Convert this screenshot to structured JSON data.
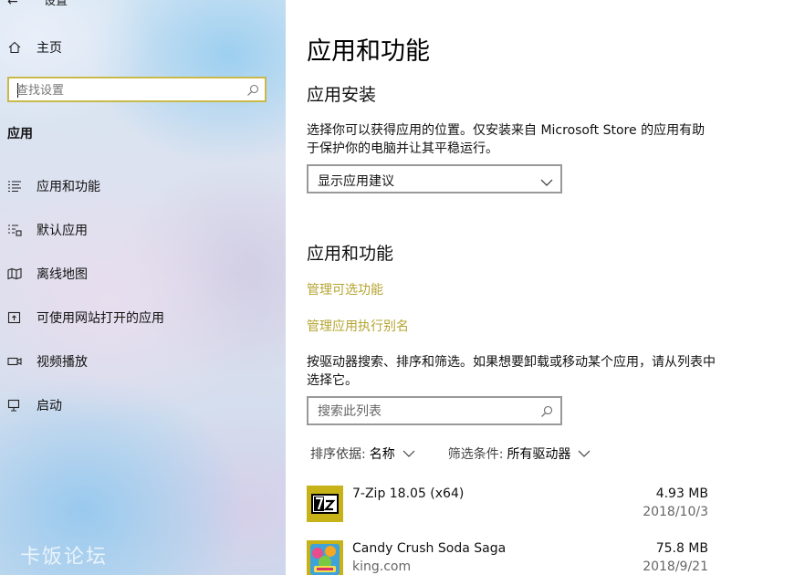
{
  "sidebar": {
    "back_title": "设置",
    "home_label": "主页",
    "search_placeholder": "查找设置",
    "section_title": "应用",
    "items": [
      {
        "label": "应用和功能",
        "icon": "apps-features-icon"
      },
      {
        "label": "默认应用",
        "icon": "default-apps-icon"
      },
      {
        "label": "离线地图",
        "icon": "offline-maps-icon"
      },
      {
        "label": "可使用网站打开的应用",
        "icon": "apps-for-websites-icon"
      },
      {
        "label": "视频播放",
        "icon": "video-playback-icon"
      },
      {
        "label": "启动",
        "icon": "startup-icon"
      }
    ],
    "watermark": "卡饭论坛"
  },
  "main": {
    "title": "应用和功能",
    "install_heading": "应用安装",
    "install_description": "选择你可以获得应用的位置。仅安装来自 Microsoft Store 的应用有助于保护你的电脑并让其平稳运行。",
    "install_dropdown_value": "显示应用建议",
    "features_heading": "应用和功能",
    "link_optional_features": "管理可选功能",
    "link_app_aliases": "管理应用执行别名",
    "list_description": "按驱动器搜索、排序和筛选。如果想要卸载或移动某个应用，请从列表中选择它。",
    "list_search_placeholder": "搜索此列表",
    "sort_label": "排序依据:",
    "sort_value": "名称",
    "filter_label": "筛选条件:",
    "filter_value": "所有驱动器",
    "apps": [
      {
        "name": "7-Zip 18.05 (x64)",
        "publisher": "",
        "size": "4.93 MB",
        "date": "2018/10/3",
        "icon": "7zip-icon"
      },
      {
        "name": "Candy Crush Soda Saga",
        "publisher": "king.com",
        "size": "75.8 MB",
        "date": "2018/9/21",
        "icon": "candy-crush-icon"
      }
    ]
  },
  "colors": {
    "accent_link": "#b5a431",
    "search_focus_border": "#c8b94a",
    "control_border": "#999999",
    "app_tile_bg": "#c7b218"
  }
}
